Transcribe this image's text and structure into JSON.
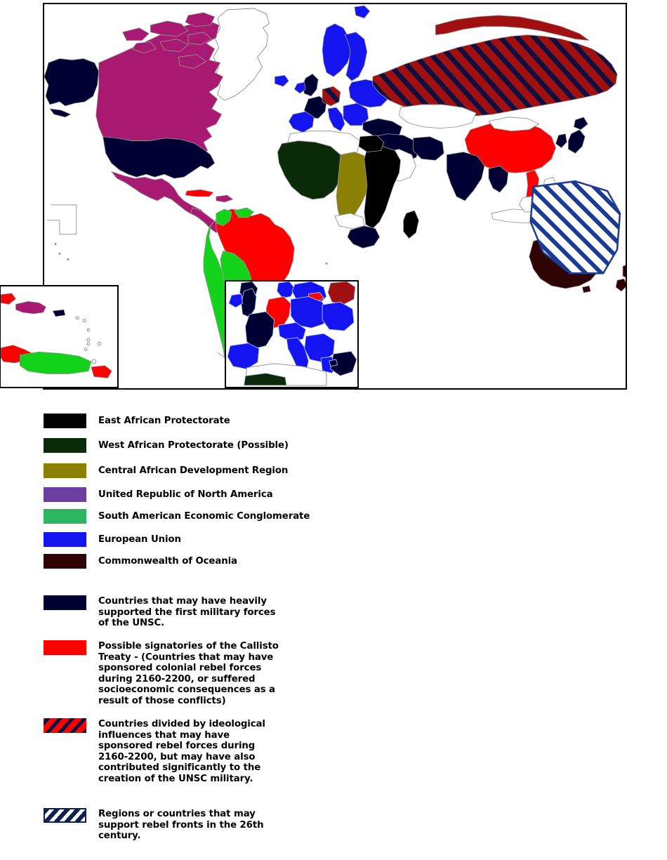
{
  "map": {
    "title": "World political affiliation map",
    "frame_border_color": "#000000",
    "ocean_color": "#ffffff",
    "country_outline_color": "#8a8a8a",
    "insets": [
      {
        "name": "caribbean-inset",
        "label": ""
      },
      {
        "name": "europe-inset",
        "label": ""
      }
    ]
  },
  "colors": {
    "east_african_protectorate": "#000000",
    "west_african_protectorate": "#0b2b08",
    "central_african_development": "#8a8006",
    "united_republic_north_america": "#6b3fa0",
    "north_america_map_fill": "#a81a72",
    "south_american_conglomerate": "#2eb561",
    "south_america_map_fill": "#12d21a",
    "european_union": "#1414f0",
    "commonwealth_of_oceania": "#2e0404",
    "unsc_supporters_navy": "#000033",
    "callisto_signatories_red": "#ff0000",
    "divided_hatch_base": "#a01010",
    "divided_hatch_stripe": "#101040",
    "rebel_front_hatch_stripe": "#1a3a96",
    "rebel_front_hatch_base": "#ffffff",
    "rebel_front_border": "#0d2050"
  },
  "legend": {
    "entries": [
      {
        "id": "east-african-protectorate",
        "label": "East African Protectorate",
        "swatch_type": "solid",
        "color": "#000000"
      },
      {
        "id": "west-african-protectorate",
        "label": "West African Protectorate (Possible)",
        "swatch_type": "solid",
        "color": "#0b2b08"
      },
      {
        "id": "central-african-development-region",
        "label": "Central African Development Region",
        "swatch_type": "solid",
        "color": "#8a8006"
      },
      {
        "id": "united-republic-of-north-america",
        "label": "United Republic of North America",
        "swatch_type": "solid",
        "color": "#6b3fa0"
      },
      {
        "id": "south-american-economic-conglomerate",
        "label": "South American Economic Conglomerate",
        "swatch_type": "solid",
        "color": "#2eb561"
      },
      {
        "id": "european-union",
        "label": "European Union",
        "swatch_type": "solid",
        "color": "#1414f0"
      },
      {
        "id": "commonwealth-of-oceania",
        "label": "Commonwealth of Oceania",
        "swatch_type": "solid",
        "color": "#2e0404"
      },
      {
        "id": "unsc-supporters",
        "label": "Countries that may have heavily supported the first military forces of the UNSC.",
        "swatch_type": "solid",
        "color": "#000033"
      },
      {
        "id": "callisto-treaty-signatories",
        "label": "Possible signatories of the Callisto Treaty - (Countries that may have sponsored colonial rebel forces during 2160-2200, or suffered socioeconomic consequences as a result of those conflicts)",
        "swatch_type": "solid",
        "color": "#ff0000"
      },
      {
        "id": "ideologically-divided-countries",
        "label": "Countries divided by ideological influences that may have sponsored rebel forces during 2160-2200, but may have also contributed significantly to the creation of the UNSC military.",
        "swatch_type": "hatch-red-navy",
        "color": "#a01010"
      },
      {
        "id": "rebel-front-support-regions",
        "label": "Regions or countries that may support rebel fronts in the 26th century.",
        "swatch_type": "hatch-navy-white",
        "color": "#1a3a96"
      }
    ]
  }
}
